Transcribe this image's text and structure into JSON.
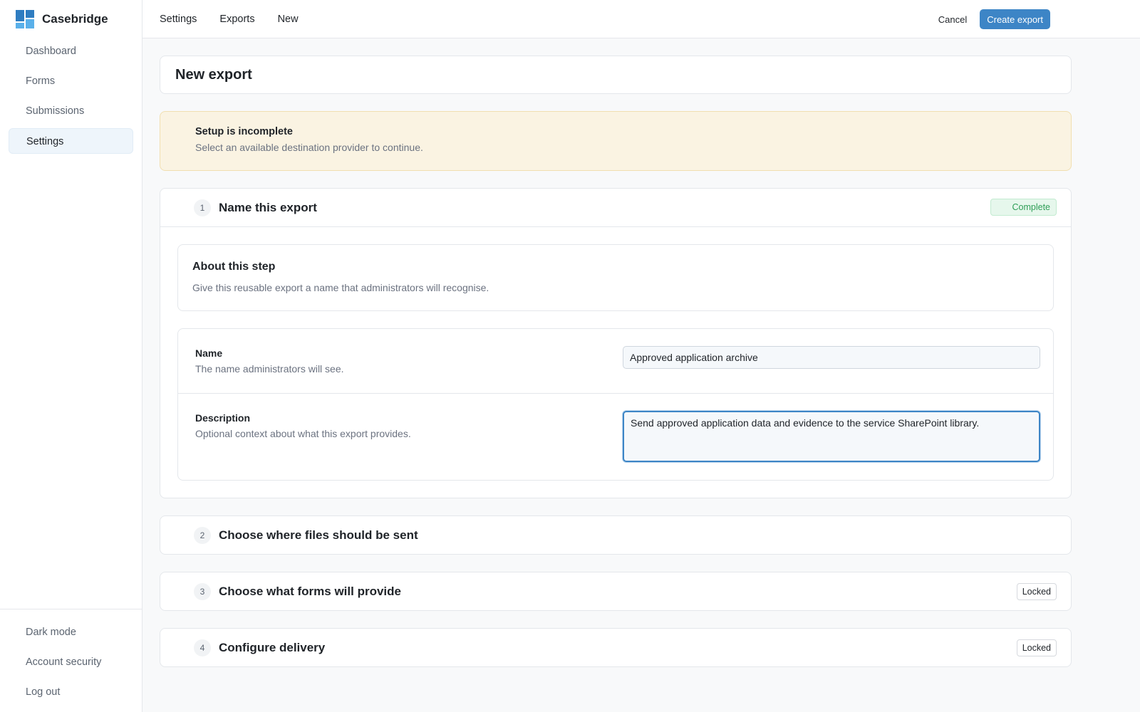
{
  "brand": {
    "name": "Casebridge",
    "logo_icon": "casebridge-logo-icon"
  },
  "sidebar": {
    "items": [
      {
        "label": "Dashboard",
        "active": false
      },
      {
        "label": "Forms",
        "active": false
      },
      {
        "label": "Submissions",
        "active": false
      },
      {
        "label": "Settings",
        "active": true
      }
    ],
    "bottom_items": [
      {
        "label": "Dark mode"
      },
      {
        "label": "Account security"
      },
      {
        "label": "Log out"
      }
    ]
  },
  "topbar": {
    "breadcrumbs": [
      "Settings",
      "Exports",
      "New"
    ],
    "cancel_label": "Cancel",
    "create_label": "Create export",
    "primary_color": "#3d85c6"
  },
  "page": {
    "title": "New export"
  },
  "alert": {
    "title": "Setup is incomplete",
    "body": "Select an available destination provider to continue.",
    "background": "#faf3e2"
  },
  "steps": [
    {
      "number": "1",
      "title": "Name this export",
      "status": "Complete",
      "expanded": true
    },
    {
      "number": "2",
      "title": "Choose where files should be sent",
      "status": "",
      "expanded": false
    },
    {
      "number": "3",
      "title": "Choose what forms will provide",
      "status": "Locked",
      "expanded": false
    },
    {
      "number": "4",
      "title": "Configure delivery",
      "status": "Locked",
      "expanded": false
    }
  ],
  "about": {
    "title": "About this step",
    "text": "Give this reusable export a name that administrators will recognise."
  },
  "fields": {
    "name": {
      "label": "Name",
      "help": "The name administrators will see.",
      "value": "Approved application archive"
    },
    "description": {
      "label": "Description",
      "help": "Optional context about what this export provides.",
      "value": "Send approved application data and evidence to the service SharePoint library."
    }
  }
}
